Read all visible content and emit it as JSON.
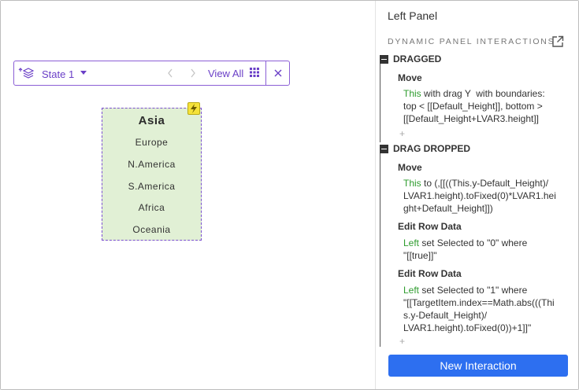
{
  "toolbar": {
    "state_label": "State 1",
    "view_all_label": "View All"
  },
  "dynamic_panel": {
    "title": "Asia",
    "items": [
      "Europe",
      "N.America",
      "S.America",
      "Africa",
      "Oceania"
    ]
  },
  "right_panel": {
    "title": "Left Panel",
    "section_header": "DYNAMIC PANEL INTERACTIONS",
    "events": [
      {
        "label": "DRAGGED",
        "actions": [
          {
            "label": "Move",
            "target": "This",
            "lines": [
              " with drag Y  with boundaries:",
              "top < [[Default_Height]], bottom >",
              "[[Default_Height+LVAR3.height]]"
            ]
          }
        ],
        "plus": "+"
      },
      {
        "label": "DRAG DROPPED",
        "actions": [
          {
            "label": "Move",
            "target": "This",
            "lines": [
              " to (,[[((This.y-Default_Height)/",
              "LVAR1.height).toFixed(0)*LVAR1.hei",
              "ght+Default_Height]])"
            ]
          },
          {
            "label": "Edit Row Data",
            "target": "Left",
            "lines": [
              " set Selected to \"0\" where",
              "\"[[true]]\""
            ]
          },
          {
            "label": "Edit Row Data",
            "target": "Left",
            "lines": [
              " set Selected to \"1\" where",
              "\"[[TargetItem.index==Math.abs(((Thi",
              "s.y-Default_Height)/",
              "LVAR1.height).toFixed(0))+1]]\""
            ]
          }
        ],
        "plus": "+"
      }
    ],
    "new_button": "New Interaction"
  },
  "colors": {
    "accent_purple": "#6a3fc7",
    "panel_fill": "#e1f0d5",
    "keyword_green": "#2e9c2e",
    "button_blue": "#2d6ff0"
  },
  "icons": [
    "layers-icon",
    "caret-down-icon",
    "chevron-left-icon",
    "chevron-right-icon",
    "grid-icon",
    "close-icon",
    "lightning-icon",
    "external-link-icon",
    "collapse-icon"
  ]
}
